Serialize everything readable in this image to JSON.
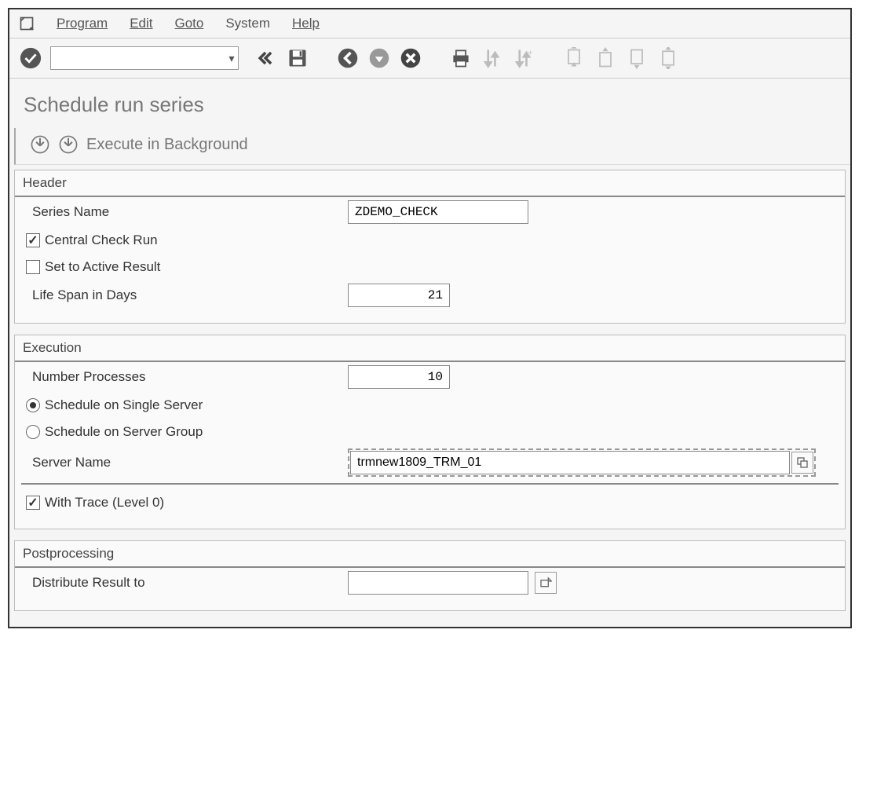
{
  "menu": {
    "program": "Program",
    "edit": "Edit",
    "goto": "Goto",
    "system": "System",
    "help": "Help"
  },
  "toolbar": {
    "command_value": ""
  },
  "page": {
    "title": "Schedule run series"
  },
  "app_toolbar": {
    "execute_bg": "Execute in Background"
  },
  "header": {
    "group_title": "Header",
    "series_name_label": "Series Name",
    "series_name_value": "ZDEMO_CHECK",
    "central_check_label": "Central Check Run",
    "central_check_checked": true,
    "set_active_label": "Set to Active Result",
    "set_active_checked": false,
    "life_span_label": "Life Span in Days",
    "life_span_value": "21"
  },
  "execution": {
    "group_title": "Execution",
    "num_proc_label": "Number Processes",
    "num_proc_value": "10",
    "single_server_label": "Schedule on Single Server",
    "server_group_label": "Schedule on Server Group",
    "schedule_choice": "single",
    "server_name_label": "Server Name",
    "server_name_value": "trmnew1809_TRM_01",
    "with_trace_label": "With Trace (Level 0)",
    "with_trace_checked": true
  },
  "post": {
    "group_title": "Postprocessing",
    "distribute_label": "Distribute Result to",
    "distribute_value": ""
  }
}
